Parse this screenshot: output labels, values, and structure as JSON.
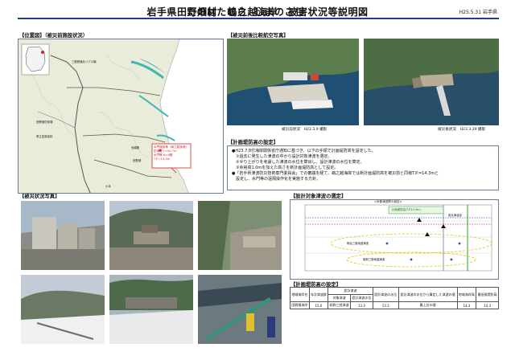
{
  "header": {
    "title_main": "岩手県田野畑村　嶋之越海岸　被害状況等説明図",
    "ruby_village": "たのはたむら",
    "ruby_coast": "しまのこし",
    "date": "H25.5.31",
    "org": "岩手県"
  },
  "sections": {
    "location": "【位置図】（被災前施設状況）",
    "aerial": "【被災前後比較航空写真】",
    "plan": "【計画堤防高の設定】",
    "damage": "【被災状況写真】",
    "design_wave": "【設計対象津波の選定】",
    "plan_height": "【計画堤防高の設定】"
  },
  "map": {
    "callout_line1": "水門施設等（嶋之越漁港）",
    "callout_line2": "防潮堤 L=40.7m",
    "callout_line3": "水門等 N=6基",
    "callout_line4": "T.P.=14.3m",
    "road_label": "三陸鉄道北リアス線",
    "label_office": "田野畑村役場",
    "label_school": "県立岩泉高校",
    "label_ruins": "田野畑",
    "label_port": "島越駅",
    "label_bay": "小本"
  },
  "aerial": {
    "caption_before": "被災前状況　H22.3.9 撮影",
    "caption_after": "被災後状況　H23.3.29 撮影"
  },
  "plan_text": [
    "●H23.7.8付海岸関係省庁通知に基づき、以下の手順で計画堤防高を設定した。",
    "　①過去に発生した津波の中から設計対象津波を選定。",
    "　②せり上がりを考慮した津波の水位を算出し、設計津波の水位を算定。",
    "　③余裕高1.0mを加えた高さを新計画堤防高として設定。",
    "●「岩手県津波防災技術専門委員会」での審議を経て、嶋之越海岸では新計画堤防高を被災前と同様T.P.=14.3mと",
    "　設定し、水門等の遠隔操作化を実施する方針。"
  ],
  "chart_data": {
    "type": "scatter",
    "title": "<対象津波群の設定>",
    "annotation_top": "設定津波高",
    "annotation_green": "計画堤防高(T.P.14.3m)",
    "annotation_ellipse1": "明治三陸地震津波",
    "annotation_ellipse2": "昭和三陸地震津波"
  },
  "table": {
    "unit": "単位：T.P.m",
    "header_col1": "地域海岸名",
    "header_col2": "年次津波群",
    "header_col3a": "設計津波",
    "header_col3b": "対象津波",
    "header_col3c": "設計津波水位",
    "header_col4": "設計津波の水位",
    "header_col5": "設計津波の水位から算定した津波の値",
    "header_col6": "地域海岸高",
    "header_col7": "最低限堤防高",
    "row_name": "田野畑海岸",
    "row_v1": "15.6",
    "row_v2": "昭和三陸津波",
    "row_v3": "13.3",
    "row_v4": "13.3",
    "row_v5": "最上位の値",
    "row_v6": "14.3",
    "row_v7": "14.3"
  }
}
